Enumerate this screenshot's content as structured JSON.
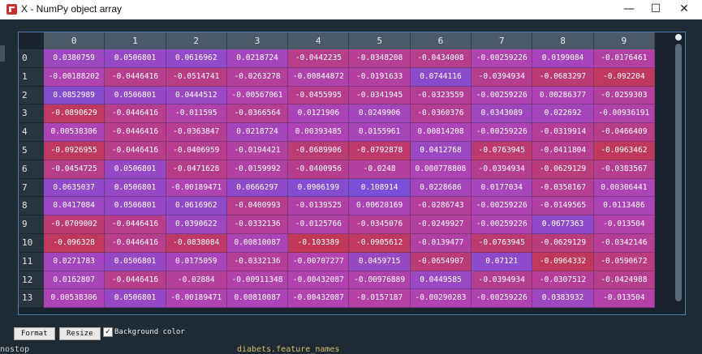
{
  "window": {
    "title": "X - NumPy object array",
    "minimize": "—",
    "maximize": "☐",
    "close": "✕"
  },
  "background": {
    "code_text": "diabets.feature_names",
    "left_text": "nostop"
  },
  "columns": [
    "0",
    "1",
    "2",
    "3",
    "4",
    "5",
    "6",
    "7",
    "8",
    "9"
  ],
  "rows": [
    "0",
    "1",
    "2",
    "3",
    "4",
    "5",
    "6",
    "7",
    "8",
    "9",
    "10",
    "11",
    "12",
    "13"
  ],
  "cells": [
    [
      "0.0380759",
      "0.0506801",
      "0.0616962",
      "0.0218724",
      "-0.0442235",
      "-0.0348208",
      "-0.0434008",
      "-0.00259226",
      "0.0199084",
      "-0.0176461"
    ],
    [
      "-0.00188202",
      "-0.0446416",
      "-0.0514741",
      "-0.0263278",
      "-0.00844872",
      "-0.0191633",
      "0.0744116",
      "-0.0394934",
      "-0.0683297",
      "-0.092204"
    ],
    [
      "0.0852989",
      "0.0506801",
      "0.0444512",
      "-0.00567061",
      "-0.0455995",
      "-0.0341945",
      "-0.0323559",
      "-0.00259226",
      "0.00286377",
      "-0.0259303"
    ],
    [
      "-0.0890629",
      "-0.0446416",
      "-0.011595",
      "-0.0366564",
      "0.0121906",
      "0.0249906",
      "-0.0360376",
      "0.0343089",
      "0.022692",
      "-0.00936191"
    ],
    [
      "0.00538306",
      "-0.0446416",
      "-0.0363847",
      "0.0218724",
      "0.00393485",
      "0.0155961",
      "0.00814208",
      "-0.00259226",
      "-0.0319914",
      "-0.0466409"
    ],
    [
      "-0.0926955",
      "-0.0446416",
      "-0.0406959",
      "-0.0194421",
      "-0.0689906",
      "-0.0792878",
      "0.0412768",
      "-0.0763945",
      "-0.0411804",
      "-0.0963462"
    ],
    [
      "-0.0454725",
      "0.0506801",
      "-0.0471628",
      "-0.0159992",
      "-0.0400956",
      "-0.0248",
      "0.000778808",
      "-0.0394934",
      "-0.0629129",
      "-0.0383567"
    ],
    [
      "0.0635037",
      "0.0506801",
      "-0.00189471",
      "0.0666297",
      "0.0906199",
      "0.108914",
      "0.0228686",
      "0.0177034",
      "-0.0358167",
      "0.00306441"
    ],
    [
      "0.0417084",
      "0.0506801",
      "0.0616962",
      "-0.0400993",
      "-0.0139525",
      "0.00620169",
      "-0.0286743",
      "-0.00259226",
      "-0.0149565",
      "0.0113486"
    ],
    [
      "-0.0709002",
      "-0.0446416",
      "0.0390622",
      "-0.0332136",
      "-0.0125766",
      "-0.0345076",
      "-0.0249927",
      "-0.00259226",
      "0.0677363",
      "-0.013504"
    ],
    [
      "-0.096328",
      "-0.0446416",
      "-0.0838084",
      "0.00810087",
      "-0.103389",
      "-0.0905612",
      "-0.0139477",
      "-0.0763945",
      "-0.0629129",
      "-0.0342146"
    ],
    [
      "0.0271783",
      "0.0506801",
      "0.0175059",
      "-0.0332136",
      "-0.00707277",
      "0.0459715",
      "-0.0654907",
      "0.07121",
      "-0.0964332",
      "-0.0590672"
    ],
    [
      "0.0162807",
      "-0.0446416",
      "-0.02884",
      "-0.00911348",
      "-0.00432087",
      "-0.00976889",
      "0.0449585",
      "-0.0394934",
      "-0.0307512",
      "-0.0424988"
    ],
    [
      "0.00538306",
      "0.0506801",
      "-0.00189471",
      "0.00810087",
      "-0.00432087",
      "-0.0157187",
      "-0.00290283",
      "-0.00259226",
      "0.0383932",
      "-0.013504"
    ]
  ],
  "buttons": {
    "format": "Format",
    "resize": "Resize"
  },
  "checkbox": {
    "label": "Background color",
    "checked": true,
    "mark": "✓"
  },
  "colors": {
    "high": "#7a4fd8",
    "mid": "#b043b4",
    "low": "#c2364f",
    "range": [
      -0.11,
      0.11
    ]
  }
}
